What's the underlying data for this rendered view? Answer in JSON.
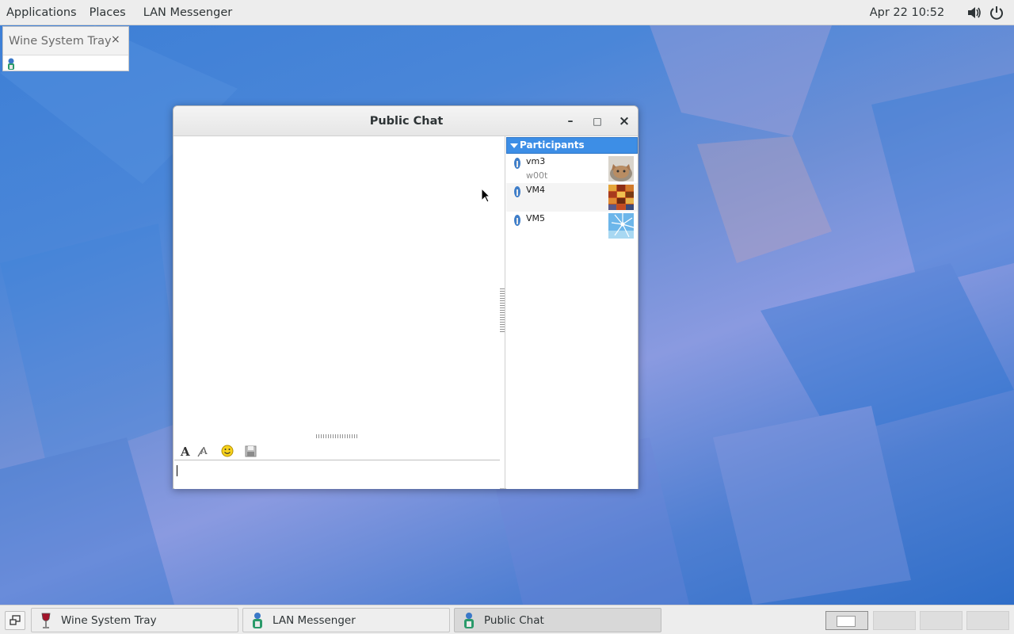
{
  "topbar": {
    "menus": [
      "Applications",
      "Places",
      "LAN Messenger"
    ],
    "clock": "Apr 22  10:52",
    "volume_icon": "speaker-icon",
    "power_icon": "power-icon"
  },
  "tray": {
    "title": "Wine System Tray",
    "close": "×"
  },
  "chat": {
    "title": "Public Chat",
    "minimize": "–",
    "maximize": "□",
    "close": "×",
    "input_value": "",
    "participants_header": "Participants",
    "participants": [
      {
        "name": "vm3",
        "status": "w00t",
        "avatar": "cat-photo"
      },
      {
        "name": "VM4",
        "status": "",
        "avatar": "colorful-tiles"
      },
      {
        "name": "VM5",
        "status": "",
        "avatar": "blue-sky-wheel"
      }
    ],
    "toolbar_icons": [
      "font-icon",
      "font-color-icon",
      "smiley-icon",
      "save-icon"
    ]
  },
  "taskbar": {
    "tasks": [
      {
        "label": "Wine System Tray",
        "active": false
      },
      {
        "label": "LAN Messenger",
        "active": false
      },
      {
        "label": "Public Chat",
        "active": true
      }
    ],
    "workspaces": 4,
    "active_workspace": 1
  }
}
